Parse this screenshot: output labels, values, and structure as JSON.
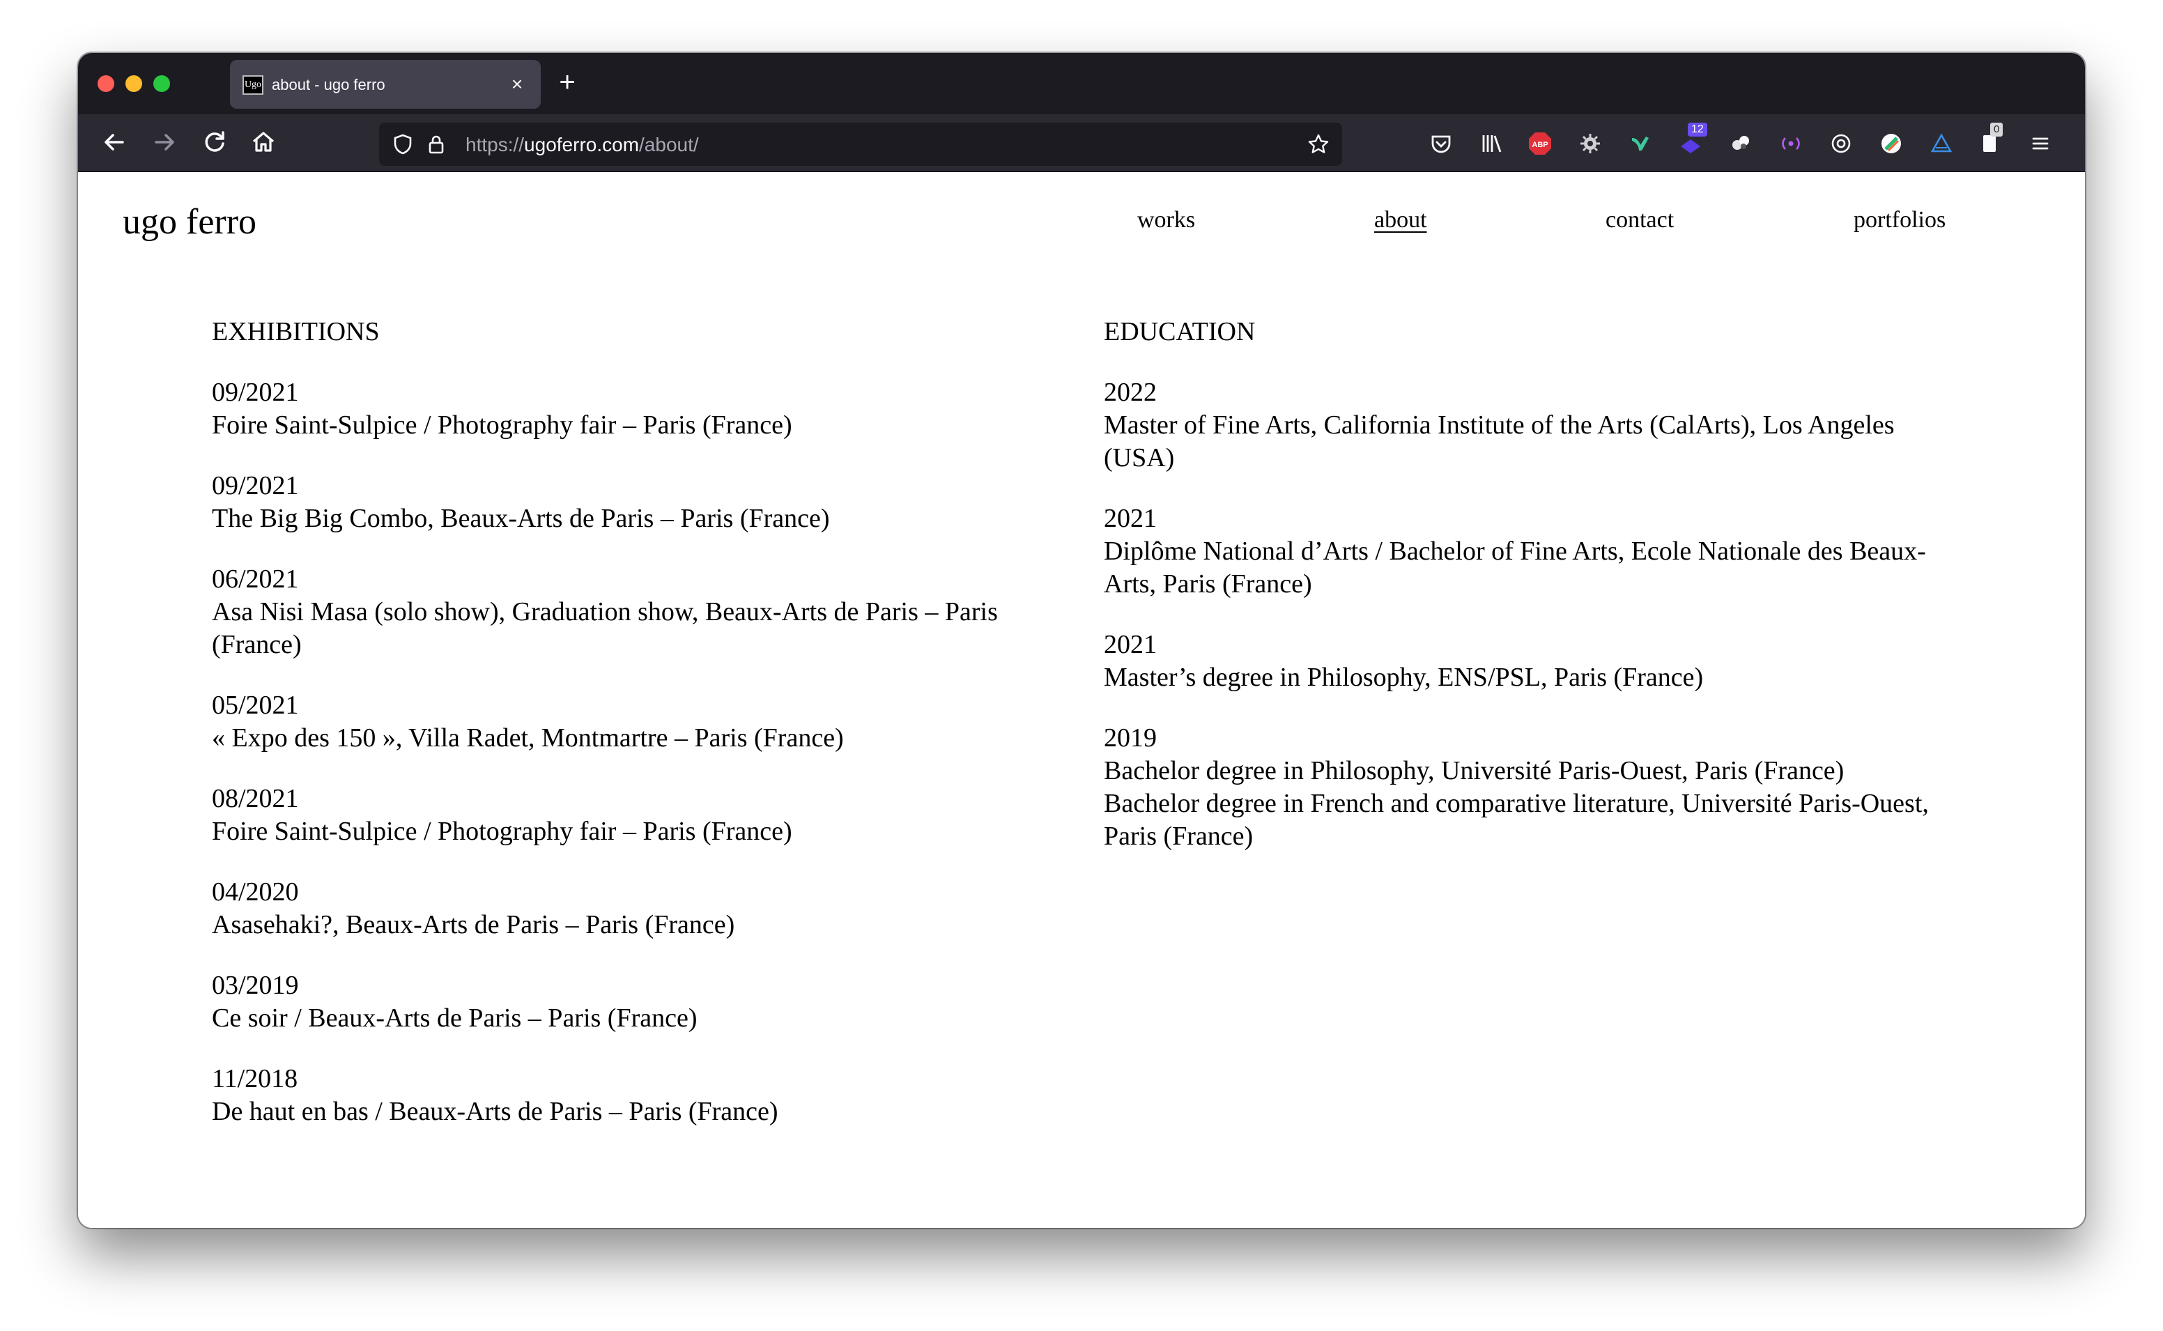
{
  "browser": {
    "tab_title": "about - ugo ferro",
    "tab_favicon_text": "Ugo",
    "url_scheme": "https://",
    "url_domain": "ugoferro.com",
    "url_path": "/about/",
    "extension_badges": {
      "purple_badge": "12",
      "clipboard_badge": "0",
      "abp": "ABP"
    }
  },
  "site": {
    "title": "ugo ferro",
    "nav": {
      "works": "works",
      "about": "about",
      "contact": "contact",
      "portfolios": "portfolios"
    }
  },
  "exhibitions": {
    "heading": "EXHIBITIONS",
    "items": [
      {
        "date": "09/2021",
        "desc": "Foire Saint-Sulpice / Photography fair – Paris (France)"
      },
      {
        "date": "09/2021",
        "desc": "The Big Big Combo, Beaux-Arts de Paris – Paris (France)"
      },
      {
        "date": "06/2021",
        "desc": "Asa Nisi Masa (solo show), Graduation show, Beaux-Arts de Paris – Paris (France)"
      },
      {
        "date": "05/2021",
        "desc": "« Expo des 150 », Villa Radet, Montmartre – Paris (France)"
      },
      {
        "date": "08/2021",
        "desc": "Foire Saint-Sulpice / Photography fair – Paris (France)"
      },
      {
        "date": "04/2020",
        "desc": "Asasehaki?, Beaux-Arts de Paris – Paris (France)"
      },
      {
        "date": "03/2019",
        "desc": "Ce soir / Beaux-Arts de Paris – Paris (France)"
      },
      {
        "date": "11/2018",
        "desc": "De haut en bas / Beaux-Arts de Paris – Paris (France)"
      }
    ]
  },
  "education": {
    "heading": "EDUCATION",
    "items": [
      {
        "date": "2022",
        "lines": [
          "Master of Fine Arts, California Institute of the Arts (CalArts), Los Angeles (USA)"
        ]
      },
      {
        "date": "2021",
        "lines": [
          "Diplôme National d’Arts / Bachelor of Fine Arts, Ecole Nationale des Beaux-Arts, Paris (France)"
        ]
      },
      {
        "date": "2021",
        "lines": [
          "Master’s degree in Philosophy, ENS/PSL, Paris (France)"
        ]
      },
      {
        "date": "2019",
        "lines": [
          "Bachelor degree in Philosophy, Université Paris-Ouest, Paris (France)",
          "Bachelor degree in French and comparative literature, Université Paris-Ouest, Paris (France)"
        ]
      }
    ]
  }
}
